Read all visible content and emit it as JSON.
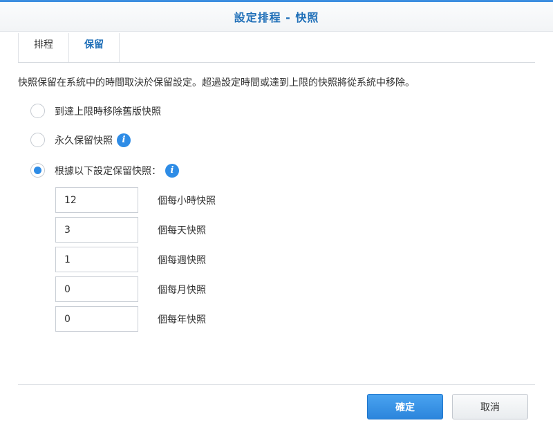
{
  "dialog": {
    "title": "設定排程 - 快照"
  },
  "tabs": [
    {
      "label": "排程",
      "active": false
    },
    {
      "label": "保留",
      "active": true
    }
  ],
  "description": "快照保留在系統中的時間取決於保留設定。超過設定時間或達到上限的快照將從系統中移除。",
  "options": [
    {
      "label": "到達上限時移除舊版快照",
      "checked": false,
      "has_info": false
    },
    {
      "label": "永久保留快照",
      "checked": false,
      "has_info": true,
      "icon": "info-icon"
    },
    {
      "label": "根據以下設定保留快照：",
      "checked": true,
      "has_info": true,
      "icon": "info-icon"
    }
  ],
  "retention_fields": [
    {
      "value": "12",
      "label": "個每小時快照"
    },
    {
      "value": "3",
      "label": "個每天快照"
    },
    {
      "value": "1",
      "label": "個每週快照"
    },
    {
      "value": "0",
      "label": "個每月快照"
    },
    {
      "value": "0",
      "label": "個每年快照"
    }
  ],
  "buttons": {
    "ok_label": "確定",
    "cancel_label": "取消"
  },
  "colors": {
    "accent": "#2e8ce6",
    "title_text": "#1f6fb8"
  }
}
